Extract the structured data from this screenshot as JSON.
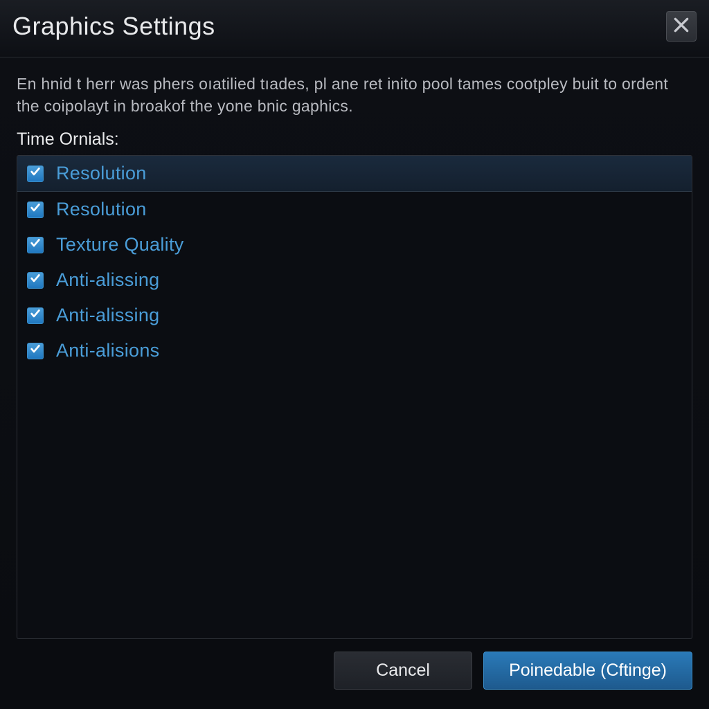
{
  "dialog": {
    "title": "Graphics Settings",
    "description": "En hnid t herr was phers oıatilied tıades, pl ane ret inito pool tames cootpley buit to ordent the coipolayt in broakof the yone bnic gaphics.",
    "section_label": "Time Ornials:",
    "options": [
      {
        "label": "Resolution",
        "checked": true,
        "highlighted": true
      },
      {
        "label": "Resolution",
        "checked": true,
        "highlighted": false
      },
      {
        "label": "Texture Quality",
        "checked": true,
        "highlighted": false
      },
      {
        "label": "Anti-alissing",
        "checked": true,
        "highlighted": false
      },
      {
        "label": "Anti-alissing",
        "checked": true,
        "highlighted": false
      },
      {
        "label": "Anti-alisions",
        "checked": true,
        "highlighted": false
      }
    ],
    "buttons": {
      "cancel": "Cancel",
      "primary": "Poinedable (Cftinge)"
    }
  }
}
